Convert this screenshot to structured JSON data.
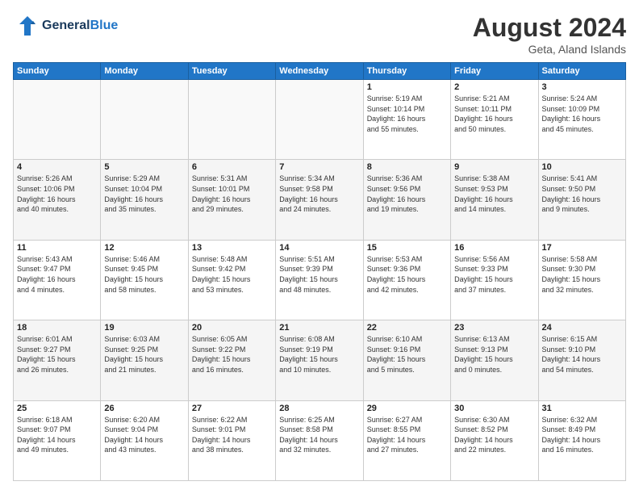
{
  "header": {
    "logo_line1": "General",
    "logo_line2": "Blue",
    "month_year": "August 2024",
    "location": "Geta, Aland Islands"
  },
  "weekdays": [
    "Sunday",
    "Monday",
    "Tuesday",
    "Wednesday",
    "Thursday",
    "Friday",
    "Saturday"
  ],
  "weeks": [
    [
      {
        "day": "",
        "info": ""
      },
      {
        "day": "",
        "info": ""
      },
      {
        "day": "",
        "info": ""
      },
      {
        "day": "",
        "info": ""
      },
      {
        "day": "1",
        "info": "Sunrise: 5:19 AM\nSunset: 10:14 PM\nDaylight: 16 hours\nand 55 minutes."
      },
      {
        "day": "2",
        "info": "Sunrise: 5:21 AM\nSunset: 10:11 PM\nDaylight: 16 hours\nand 50 minutes."
      },
      {
        "day": "3",
        "info": "Sunrise: 5:24 AM\nSunset: 10:09 PM\nDaylight: 16 hours\nand 45 minutes."
      }
    ],
    [
      {
        "day": "4",
        "info": "Sunrise: 5:26 AM\nSunset: 10:06 PM\nDaylight: 16 hours\nand 40 minutes."
      },
      {
        "day": "5",
        "info": "Sunrise: 5:29 AM\nSunset: 10:04 PM\nDaylight: 16 hours\nand 35 minutes."
      },
      {
        "day": "6",
        "info": "Sunrise: 5:31 AM\nSunset: 10:01 PM\nDaylight: 16 hours\nand 29 minutes."
      },
      {
        "day": "7",
        "info": "Sunrise: 5:34 AM\nSunset: 9:58 PM\nDaylight: 16 hours\nand 24 minutes."
      },
      {
        "day": "8",
        "info": "Sunrise: 5:36 AM\nSunset: 9:56 PM\nDaylight: 16 hours\nand 19 minutes."
      },
      {
        "day": "9",
        "info": "Sunrise: 5:38 AM\nSunset: 9:53 PM\nDaylight: 16 hours\nand 14 minutes."
      },
      {
        "day": "10",
        "info": "Sunrise: 5:41 AM\nSunset: 9:50 PM\nDaylight: 16 hours\nand 9 minutes."
      }
    ],
    [
      {
        "day": "11",
        "info": "Sunrise: 5:43 AM\nSunset: 9:47 PM\nDaylight: 16 hours\nand 4 minutes."
      },
      {
        "day": "12",
        "info": "Sunrise: 5:46 AM\nSunset: 9:45 PM\nDaylight: 15 hours\nand 58 minutes."
      },
      {
        "day": "13",
        "info": "Sunrise: 5:48 AM\nSunset: 9:42 PM\nDaylight: 15 hours\nand 53 minutes."
      },
      {
        "day": "14",
        "info": "Sunrise: 5:51 AM\nSunset: 9:39 PM\nDaylight: 15 hours\nand 48 minutes."
      },
      {
        "day": "15",
        "info": "Sunrise: 5:53 AM\nSunset: 9:36 PM\nDaylight: 15 hours\nand 42 minutes."
      },
      {
        "day": "16",
        "info": "Sunrise: 5:56 AM\nSunset: 9:33 PM\nDaylight: 15 hours\nand 37 minutes."
      },
      {
        "day": "17",
        "info": "Sunrise: 5:58 AM\nSunset: 9:30 PM\nDaylight: 15 hours\nand 32 minutes."
      }
    ],
    [
      {
        "day": "18",
        "info": "Sunrise: 6:01 AM\nSunset: 9:27 PM\nDaylight: 15 hours\nand 26 minutes."
      },
      {
        "day": "19",
        "info": "Sunrise: 6:03 AM\nSunset: 9:25 PM\nDaylight: 15 hours\nand 21 minutes."
      },
      {
        "day": "20",
        "info": "Sunrise: 6:05 AM\nSunset: 9:22 PM\nDaylight: 15 hours\nand 16 minutes."
      },
      {
        "day": "21",
        "info": "Sunrise: 6:08 AM\nSunset: 9:19 PM\nDaylight: 15 hours\nand 10 minutes."
      },
      {
        "day": "22",
        "info": "Sunrise: 6:10 AM\nSunset: 9:16 PM\nDaylight: 15 hours\nand 5 minutes."
      },
      {
        "day": "23",
        "info": "Sunrise: 6:13 AM\nSunset: 9:13 PM\nDaylight: 15 hours\nand 0 minutes."
      },
      {
        "day": "24",
        "info": "Sunrise: 6:15 AM\nSunset: 9:10 PM\nDaylight: 14 hours\nand 54 minutes."
      }
    ],
    [
      {
        "day": "25",
        "info": "Sunrise: 6:18 AM\nSunset: 9:07 PM\nDaylight: 14 hours\nand 49 minutes."
      },
      {
        "day": "26",
        "info": "Sunrise: 6:20 AM\nSunset: 9:04 PM\nDaylight: 14 hours\nand 43 minutes."
      },
      {
        "day": "27",
        "info": "Sunrise: 6:22 AM\nSunset: 9:01 PM\nDaylight: 14 hours\nand 38 minutes."
      },
      {
        "day": "28",
        "info": "Sunrise: 6:25 AM\nSunset: 8:58 PM\nDaylight: 14 hours\nand 32 minutes."
      },
      {
        "day": "29",
        "info": "Sunrise: 6:27 AM\nSunset: 8:55 PM\nDaylight: 14 hours\nand 27 minutes."
      },
      {
        "day": "30",
        "info": "Sunrise: 6:30 AM\nSunset: 8:52 PM\nDaylight: 14 hours\nand 22 minutes."
      },
      {
        "day": "31",
        "info": "Sunrise: 6:32 AM\nSunset: 8:49 PM\nDaylight: 14 hours\nand 16 minutes."
      }
    ]
  ]
}
